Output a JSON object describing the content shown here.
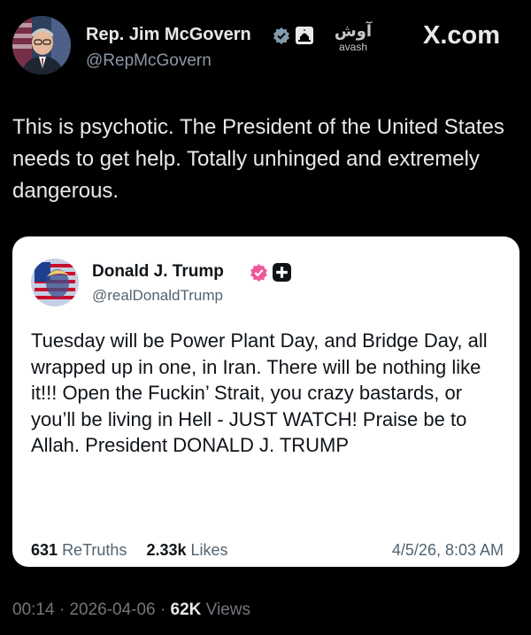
{
  "author": {
    "name": "Rep. Jim McGovern",
    "handle": "@RepMcGovern",
    "verified_color": "#829aab"
  },
  "watermark": {
    "persian": "آوش",
    "latin": "avash"
  },
  "brand": "X.com",
  "post": {
    "text": "This is psychotic. The President of the United States needs to get help. Totally unhinged and extremely dangerous."
  },
  "embedded": {
    "name": "Donald J. Trump",
    "handle": "@realDonaldTrump",
    "verified_color": "#f0589b",
    "text": "Tuesday will be Power Plant Day, and Bridge Day, all wrapped up in one, in Iran. There will be nothing like it!!! Open the Fuckin’ Strait, you crazy bastards, or you’ll be living in Hell - JUST WATCH! Praise be to Allah. President DONALD J. TRUMP",
    "retruths_count": "631",
    "retruths_label": "ReTruths",
    "likes_count": "2.33k",
    "likes_label": "Likes",
    "date": "4/5/26, 8:03 AM"
  },
  "meta": {
    "time": "00:14",
    "sep1": "·",
    "date": "2026-04-06",
    "sep2": "·",
    "views_count": "62K",
    "views_label": "Views"
  }
}
